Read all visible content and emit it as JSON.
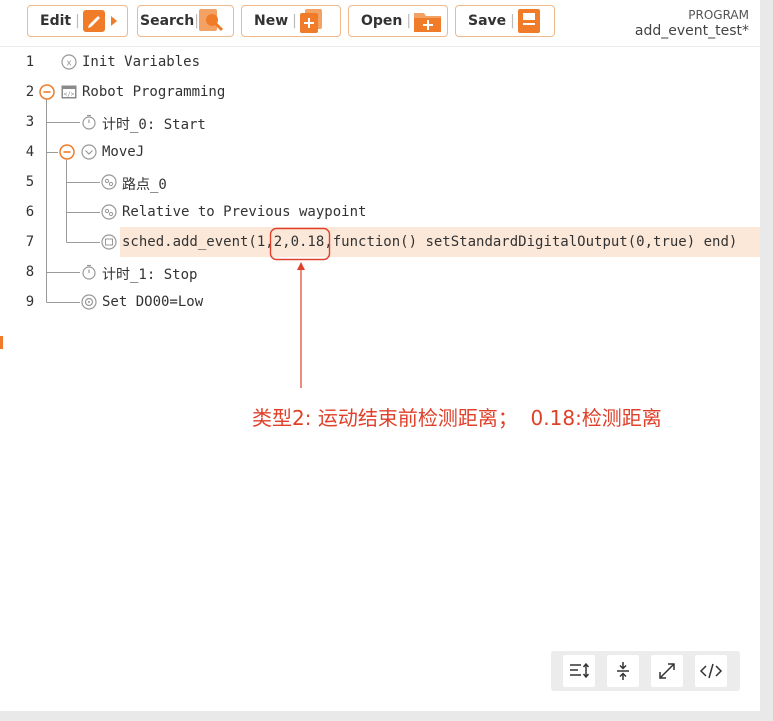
{
  "toolbar": {
    "edit_label": "Edit",
    "search_label": "Search",
    "new_label": "New",
    "open_label": "Open",
    "save_label": "Save",
    "separator": "|"
  },
  "program": {
    "label": "PROGRAM",
    "name": "add_event_test*"
  },
  "lines": [
    {
      "num": "1",
      "text": "Init Variables"
    },
    {
      "num": "2",
      "text": "Robot Programming"
    },
    {
      "num": "3",
      "text": "计时_0: Start"
    },
    {
      "num": "4",
      "text": "MoveJ"
    },
    {
      "num": "5",
      "text": "路点_0"
    },
    {
      "num": "6",
      "text": "Relative to Previous waypoint"
    },
    {
      "num": "7",
      "text_a": "sched.add_event(1,",
      "text_b": "2,0.18,",
      "text_c": "function() setStandardDigitalOutput(0,true) end)"
    },
    {
      "num": "8",
      "text": "计时_1: Stop"
    },
    {
      "num": "9",
      "text": "Set DO00=Low"
    }
  ],
  "annotation": "类型2: 运动结束前检测距离；  0.18:检测距离",
  "colors": {
    "accent": "#f07c2a",
    "annotation": "#e0402a",
    "highlight": "#fce8d9",
    "button_border": "#f0b98a"
  },
  "icons": {
    "edit": "pencil-icon",
    "search": "search-icon",
    "new": "new-file-icon",
    "open": "folder-icon",
    "save": "save-file-icon",
    "bottom": [
      "fold-lines-icon",
      "collapse-icon",
      "expand-icon",
      "code-icon"
    ]
  }
}
